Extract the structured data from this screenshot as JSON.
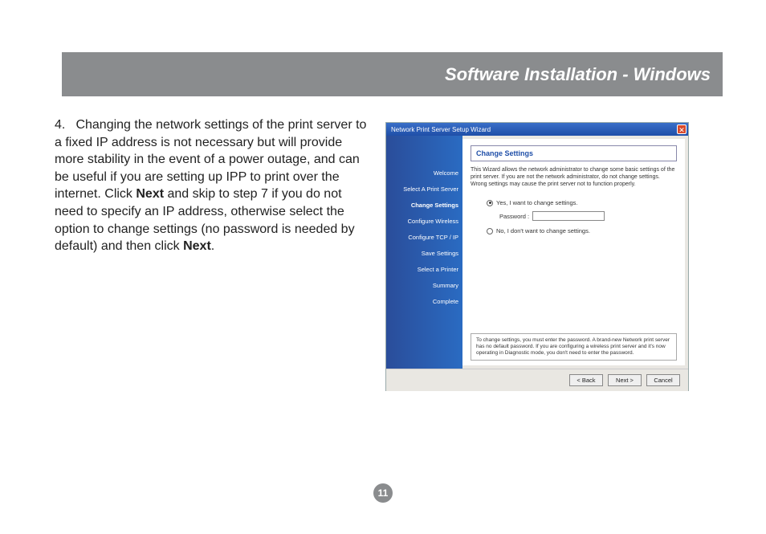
{
  "header": {
    "title": "Software Installation - Windows"
  },
  "step": {
    "number": "4.",
    "text_before_next1": "Changing the network settings of the print server to a fixed IP address is not necessary but will provide more stability in the event of a power outage, and can be useful if you are setting up IPP to print over the internet.  Click ",
    "next1": "Next",
    "text_mid": " and skip to step 7 if you do not need to specify an IP address, otherwise select the option to change settings (no password is needed by default) and then click ",
    "next2": "Next",
    "text_end": "."
  },
  "page_number": "11",
  "wizard": {
    "title": "Network Print Server Setup Wizard",
    "close": "✕",
    "sidebar": {
      "items": [
        "Welcome",
        "Select A Print Server",
        "Change Settings",
        "Configure Wireless",
        "Configure TCP / IP",
        "Save Settings",
        "Select a Printer",
        "Summary",
        "Complete"
      ],
      "active_index": 2
    },
    "content": {
      "heading": "Change Settings",
      "description": "This Wizard allows the network administrator to change some basic settings of the print server. If you are not the network administrator, do not change settings. Wrong settings may cause the print server not to function properly.",
      "option_yes": "Yes, I want to change settings.",
      "password_label": "Password :",
      "password_value": "",
      "option_no": "No, I don't want to change settings.",
      "note": "To change settings, you must enter the password. A brand-new Network print server has no default password. If you are configuring a wireless print server and it's now operating in Diagnostic mode, you don't need to enter the password."
    },
    "buttons": {
      "back": "< Back",
      "next": "Next >",
      "cancel": "Cancel"
    }
  }
}
